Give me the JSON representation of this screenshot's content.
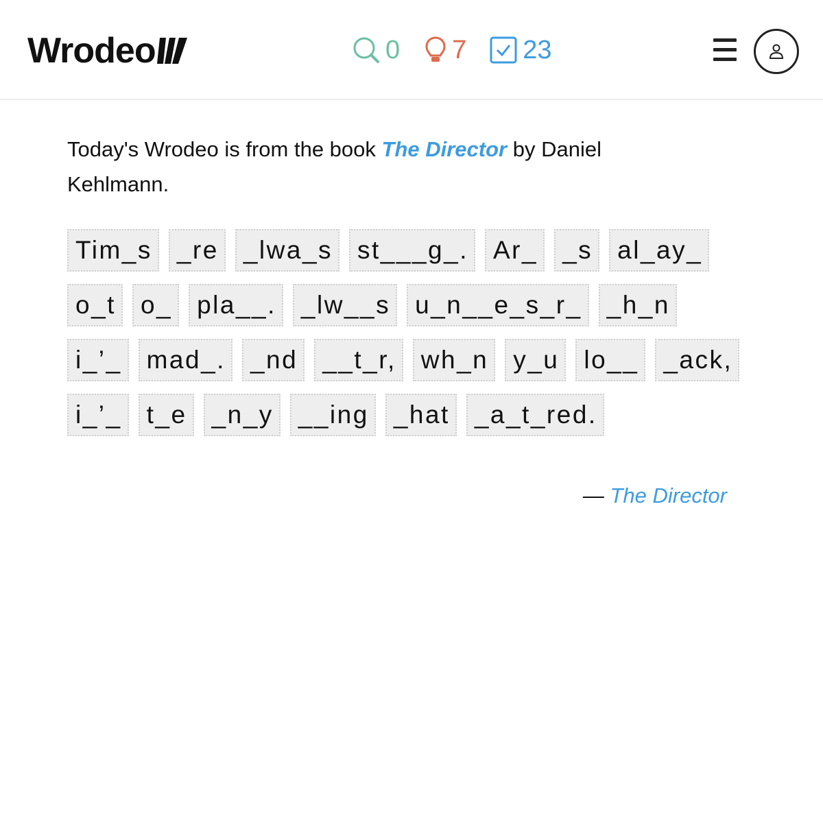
{
  "header": {
    "logo_text": "Wrodeo",
    "stats": {
      "searches": "0",
      "hints": "7",
      "solved": "23"
    },
    "colors": {
      "search": "#6bbfa0",
      "hint": "#de6a4c",
      "solved": "#3d9be0"
    },
    "icons": {
      "search": "search-icon",
      "hint": "lightbulb-icon",
      "solved": "checkbox-icon",
      "menu": "hamburger-menu-icon",
      "account": "user-icon"
    }
  },
  "intro": {
    "prefix": "Today's Wrodeo is from the book ",
    "book_title": "The Director",
    "suffix": " by Daniel Kehlmann."
  },
  "puzzle": {
    "words": [
      "Tim_s",
      "_re",
      "_lwa_s",
      "st___g_.",
      "Ar_",
      "_s",
      "al_ay_",
      "o_t",
      "o_",
      "pla__.",
      "_lw__s",
      "u_n__e_s_r_",
      "_h_n",
      "i_’_",
      "mad_.",
      "_nd",
      "__t_r,",
      "wh_n",
      "y_u",
      "lo__",
      "_ack,",
      "i_’_",
      "t_e",
      "_n_y",
      "__ing",
      "_hat",
      "_a_t_red."
    ]
  },
  "attribution": {
    "dash": "— ",
    "title": "The Director"
  }
}
